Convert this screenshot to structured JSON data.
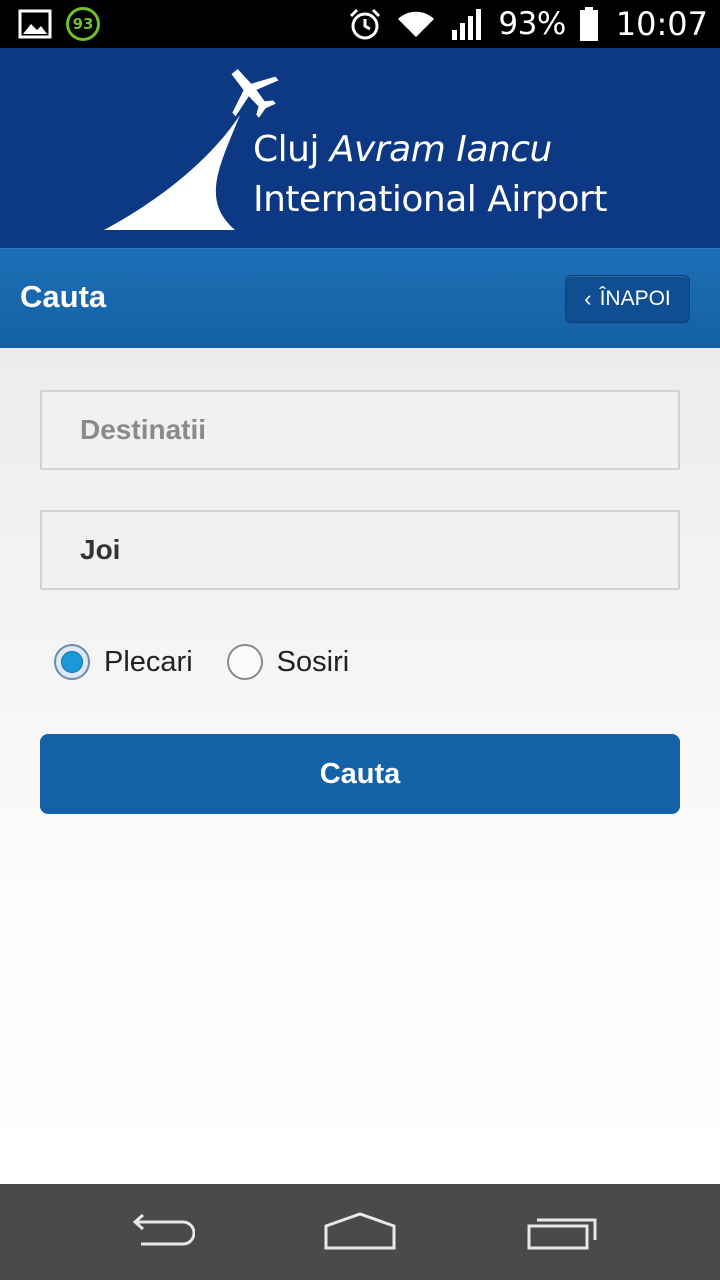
{
  "status_bar": {
    "notification_badge": "93",
    "battery_percent": "93%",
    "time": "10:07",
    "icons": [
      "gallery-icon",
      "badge-93-icon",
      "alarm-icon",
      "wifi-icon",
      "signal-icon",
      "battery-icon"
    ]
  },
  "header": {
    "logo_line1_regular": "Cluj ",
    "logo_line1_italic": "Avram Iancu",
    "logo_line2": "International Airport"
  },
  "titlebar": {
    "title": "Cauta",
    "back_label": "ÎNAPOI"
  },
  "form": {
    "destination_placeholder": "Destinatii",
    "destination_value": "",
    "day_value": "Joi",
    "radio_options": [
      {
        "label": "Plecari",
        "selected": true
      },
      {
        "label": "Sosiri",
        "selected": false
      }
    ],
    "submit_label": "Cauta"
  },
  "colors": {
    "header_bg": "#0d3884",
    "titlebar_bg": "#1560a4",
    "button_bg": "#1461a8",
    "radio_selected": "#1a9ad6",
    "navbar_bg": "#4a4a4a"
  }
}
